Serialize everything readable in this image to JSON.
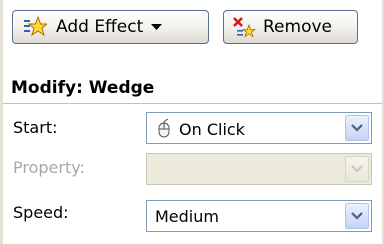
{
  "toolbar": {
    "add_effect_label": "Add Effect",
    "remove_label": "Remove"
  },
  "section": {
    "title": "Modify: Wedge"
  },
  "fields": {
    "start": {
      "label": "Start:",
      "value": "On Click"
    },
    "property": {
      "label": "Property:",
      "value": ""
    },
    "speed": {
      "label": "Speed:",
      "value": "Medium"
    }
  }
}
